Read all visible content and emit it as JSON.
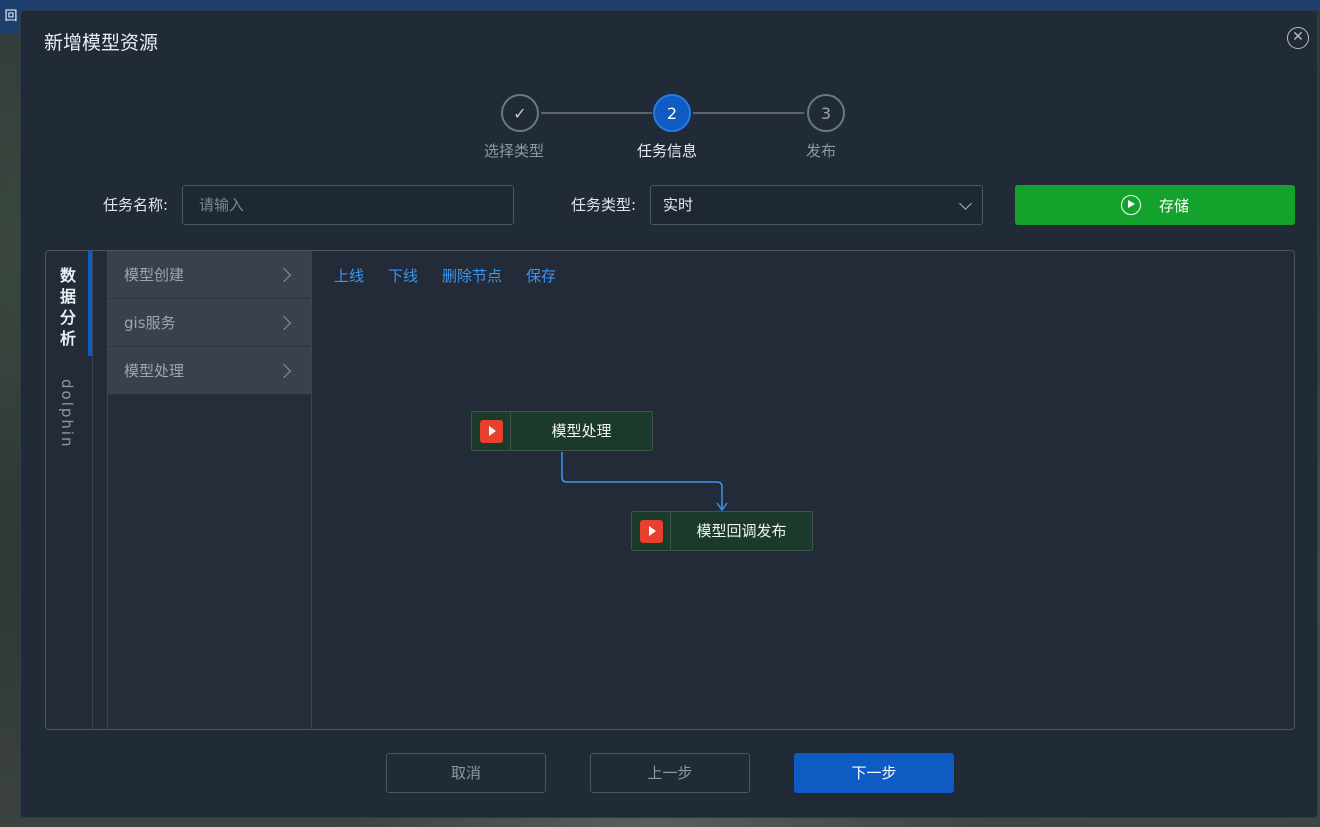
{
  "background": {
    "corner_label": "回"
  },
  "dialog": {
    "title": "新增模型资源",
    "close_icon": "close-circle-icon"
  },
  "steps": [
    {
      "index": "1",
      "label": "选择类型",
      "state": "done",
      "icon": "check-icon"
    },
    {
      "index": "2",
      "label": "任务信息",
      "state": "active"
    },
    {
      "index": "3",
      "label": "发布",
      "state": "todo"
    }
  ],
  "form": {
    "task_name_label": "任务名称:",
    "task_name_placeholder": "请输入",
    "task_type_label": "任务类型:",
    "task_type_value": "实时",
    "save_button_label": "存储",
    "save_button_icon": "play-circle-icon"
  },
  "workspace": {
    "vertical_tabs": [
      {
        "label": "数据分析",
        "active": true
      },
      {
        "label": "dolphin",
        "active": false
      }
    ],
    "menu_items": [
      {
        "label": "模型创建"
      },
      {
        "label": "gis服务"
      },
      {
        "label": "模型处理"
      }
    ],
    "toolbar": {
      "online": "上线",
      "offline": "下线",
      "delete_node": "删除节点",
      "save": "保存"
    },
    "nodes": [
      {
        "label": "模型处理",
        "icon": "play-icon"
      },
      {
        "label": "模型回调发布",
        "icon": "play-icon"
      }
    ]
  },
  "footer": {
    "cancel": "取消",
    "prev": "上一步",
    "next": "下一步"
  },
  "colors": {
    "accent": "#0e5bc4",
    "success": "#13a32d",
    "link": "#3d95f0",
    "node_icon": "#e8402f",
    "dialog_bg": "#212b38"
  }
}
